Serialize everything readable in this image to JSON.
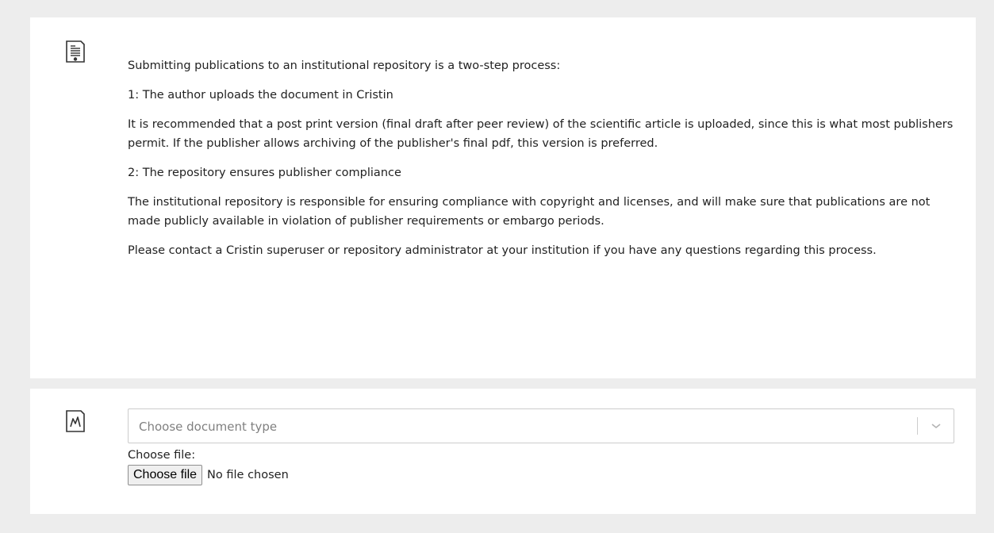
{
  "info": {
    "icon": "document-icon",
    "paragraphs": [
      "Submitting publications to an institutional repository is a two-step process:",
      "1: The author uploads the document in Cristin",
      "It is recommended that a post print version (final draft after peer review) of the scientific article is uploaded, since this is what most publishers permit. If the publisher allows archiving of the publisher's final pdf, this version is preferred.",
      "2: The repository ensures publisher compliance",
      "The institutional repository is responsible for ensuring compliance with copyright and licenses, and will make sure that publications are not made publicly available in violation of publisher requirements or embargo periods.",
      "Please contact a Cristin superuser or repository administrator at your institution if you have any questions regarding this process."
    ]
  },
  "upload": {
    "icon": "pdf-file-icon",
    "document_type": {
      "placeholder": "Choose document type",
      "selected": ""
    },
    "file_label": "Choose file:",
    "file_button_label": "Choose file",
    "file_status": "No file chosen"
  },
  "colors": {
    "page_background": "#ededed",
    "panel_background": "#ffffff",
    "border": "#cccccc",
    "placeholder": "#808080"
  }
}
